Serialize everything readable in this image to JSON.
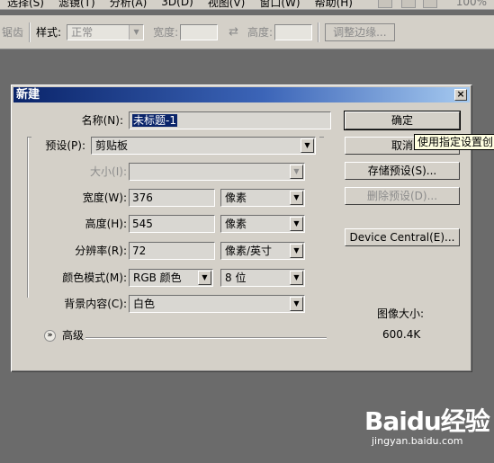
{
  "menubar": {
    "items": [
      "选择(S)",
      "滤镜(T)",
      "分析(A)",
      "3D(D)",
      "视图(V)",
      "窗口(W)",
      "帮助(H)"
    ],
    "zoom": "100%"
  },
  "optbar": {
    "anti_alias_label": "锯齿",
    "style_label": "样式:",
    "style_value": "正常",
    "width_label": "宽度:",
    "swap_glyph": "⇄",
    "height_label": "高度:",
    "refine_edge_button": "调整边缘..."
  },
  "dialog": {
    "title": "新建",
    "close_glyph": "×",
    "name_label": "名称(N):",
    "name_value": "未标题-1",
    "preset_label": "预设(P):",
    "preset_value": "剪贴板",
    "size_label": "大小(I):",
    "width_label": "宽度(W):",
    "width_value": "376",
    "width_unit": "像素",
    "height_label": "高度(H):",
    "height_value": "545",
    "height_unit": "像素",
    "resolution_label": "分辨率(R):",
    "resolution_value": "72",
    "resolution_unit": "像素/英寸",
    "color_mode_label": "颜色模式(M):",
    "color_mode_value": "RGB 颜色",
    "bit_depth_value": "8 位",
    "background_label": "背景内容(C):",
    "background_value": "白色",
    "advanced_label": "高级",
    "buttons": {
      "ok": "确定",
      "cancel": "取消",
      "save_preset": "存储预设(S)...",
      "delete_preset": "删除预设(D)...",
      "device_central": "Device Central(E)..."
    },
    "image_size_label": "图像大小:",
    "image_size_value": "600.4K",
    "tooltip": "使用指定设置创"
  },
  "watermark": {
    "logo": "Baidu经验",
    "url": "jingyan.baidu.com"
  },
  "colors": {
    "workspace": "#6b6b6b",
    "dialog_bg": "#d4d0c8",
    "title_gradient_start": "#0a246a",
    "title_gradient_end": "#a6caf0",
    "tooltip_bg": "#ffffe1"
  }
}
